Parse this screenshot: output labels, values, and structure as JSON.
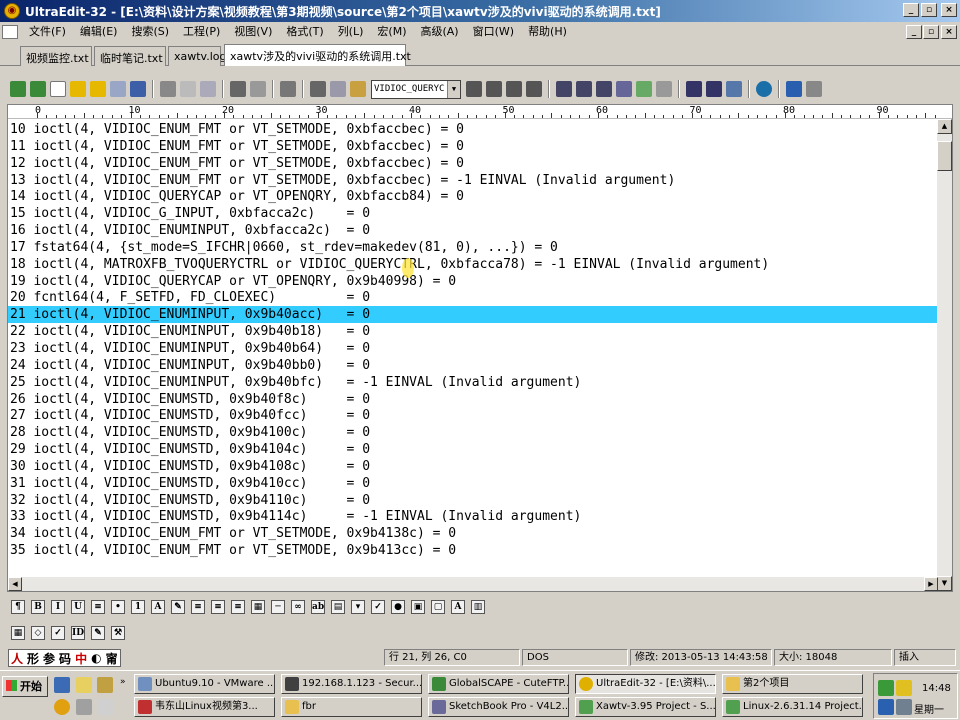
{
  "window": {
    "title": "UltraEdit-32 - [E:\\资料\\设计方案\\视频教程\\第3期视频\\source\\第2个项目\\xawtv涉及的vivi驱动的系统调用.txt]"
  },
  "menu": [
    "文件(F)",
    "编辑(E)",
    "搜索(S)",
    "工程(P)",
    "视图(V)",
    "格式(T)",
    "列(L)",
    "宏(M)",
    "高级(A)",
    "窗口(W)",
    "帮助(H)"
  ],
  "tabs": [
    "视频监控.txt",
    "临时笔记.txt",
    "xawtv.log",
    "xawtv涉及的vivi驱动的系统调用.txt"
  ],
  "toolbar": {
    "search_combo_value": "VIDIOC_QUERYC"
  },
  "ruler": [
    "0",
    "10",
    "20",
    "30",
    "40",
    "50",
    "60",
    "70",
    "80",
    "90"
  ],
  "editor": {
    "highlighted_line": 21,
    "lines": [
      "10 ioctl(4, VIDIOC_ENUM_FMT or VT_SETMODE, 0xbfaccbec) = 0",
      "11 ioctl(4, VIDIOC_ENUM_FMT or VT_SETMODE, 0xbfaccbec) = 0",
      "12 ioctl(4, VIDIOC_ENUM_FMT or VT_SETMODE, 0xbfaccbec) = 0",
      "13 ioctl(4, VIDIOC_ENUM_FMT or VT_SETMODE, 0xbfaccbec) = -1 EINVAL (Invalid argument)",
      "14 ioctl(4, VIDIOC_QUERYCAP or VT_OPENQRY, 0xbfaccb84) = 0",
      "15 ioctl(4, VIDIOC_G_INPUT, 0xbfacca2c)    = 0",
      "16 ioctl(4, VIDIOC_ENUMINPUT, 0xbfacca2c)  = 0",
      "17 fstat64(4, {st_mode=S_IFCHR|0660, st_rdev=makedev(81, 0), ...}) = 0",
      "18 ioctl(4, MATROXFB_TVOQUERYCTRL or VIDIOC_QUERYCTRL, 0xbfacca78) = -1 EINVAL (Invalid argument)",
      "19 ioctl(4, VIDIOC_QUERYCAP or VT_OPENQRY, 0x9b40998) = 0",
      "20 fcntl64(4, F_SETFD, FD_CLOEXEC)         = 0",
      "21 ioctl(4, VIDIOC_ENUMINPUT, 0x9b40acc)   = 0",
      "22 ioctl(4, VIDIOC_ENUMINPUT, 0x9b40b18)   = 0",
      "23 ioctl(4, VIDIOC_ENUMINPUT, 0x9b40b64)   = 0",
      "24 ioctl(4, VIDIOC_ENUMINPUT, 0x9b40bb0)   = 0",
      "25 ioctl(4, VIDIOC_ENUMINPUT, 0x9b40bfc)   = -1 EINVAL (Invalid argument)",
      "26 ioctl(4, VIDIOC_ENUMSTD, 0x9b40f8c)     = 0",
      "27 ioctl(4, VIDIOC_ENUMSTD, 0x9b40fcc)     = 0",
      "28 ioctl(4, VIDIOC_ENUMSTD, 0x9b4100c)     = 0",
      "29 ioctl(4, VIDIOC_ENUMSTD, 0x9b4104c)     = 0",
      "30 ioctl(4, VIDIOC_ENUMSTD, 0x9b4108c)     = 0",
      "31 ioctl(4, VIDIOC_ENUMSTD, 0x9b410cc)     = 0",
      "32 ioctl(4, VIDIOC_ENUMSTD, 0x9b4110c)     = 0",
      "33 ioctl(4, VIDIOC_ENUMSTD, 0x9b4114c)     = -1 EINVAL (Invalid argument)",
      "34 ioctl(4, VIDIOC_ENUM_FMT or VT_SETMODE, 0x9b4138c) = 0",
      "35 ioctl(4, VIDIOC_ENUM_FMT or VT_SETMODE, 0x9b413cc) = 0"
    ]
  },
  "ime": {
    "chars": [
      "形",
      "参",
      "码",
      "中",
      "◐",
      "甯"
    ]
  },
  "status": {
    "position": "行 21, 列 26, C0",
    "encoding": "DOS",
    "modified": "修改: 2013-05-13 14:43:58",
    "size": "大小: 18048",
    "mode": "插入"
  },
  "taskbar": {
    "start": "开始",
    "row1": [
      "Ubuntu9.10 - VMware ...",
      "192.168.1.123 - Secur...",
      "GlobalSCAPE - CuteFTP...",
      "UltraEdit-32 - [E:\\资料\\...",
      "第2个项目"
    ],
    "row2": [
      "韦东山Linux视频第3...",
      "fbr",
      "SketchBook Pro - V4L2...",
      "Xawtv-3.95 Project - S...",
      "Linux-2.6.31.14 Project..."
    ],
    "clock": "14:48",
    "day": "星期一"
  }
}
